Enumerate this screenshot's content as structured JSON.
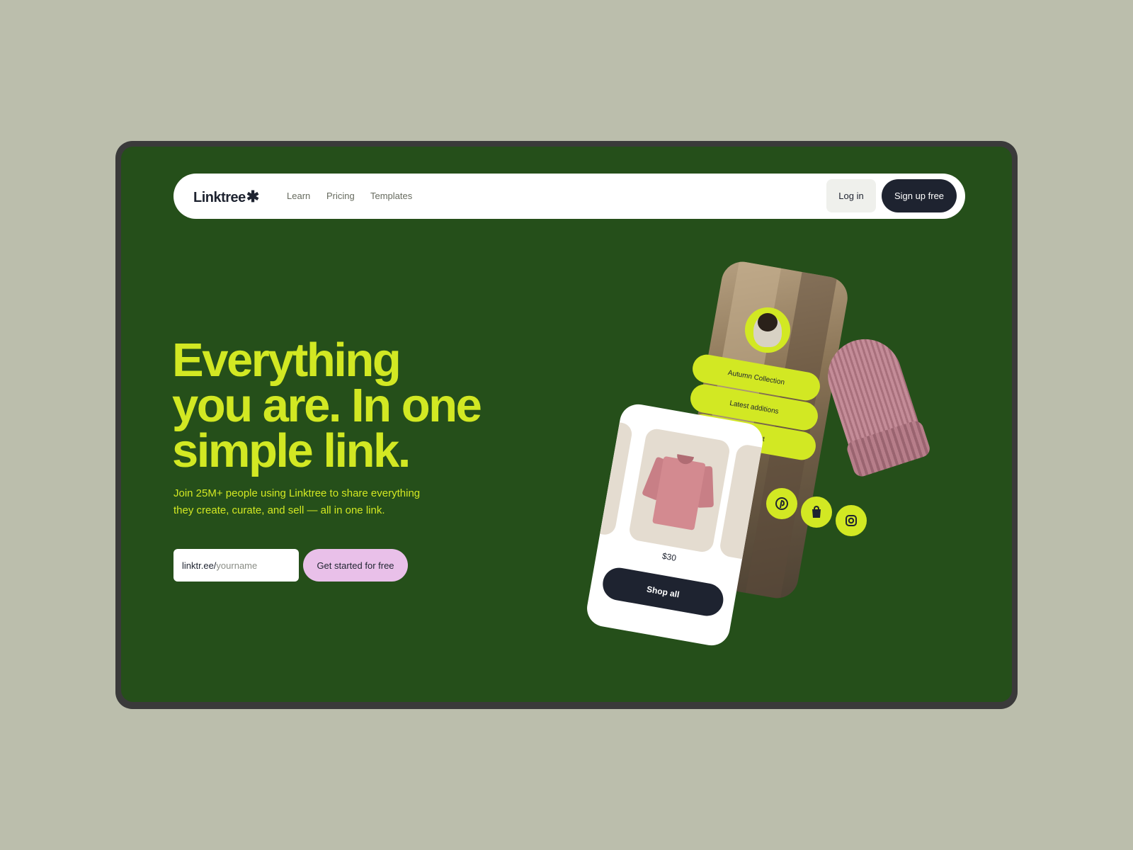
{
  "nav": {
    "logo_text": "Linktree",
    "logo_mark": "✱",
    "links": [
      "Learn",
      "Pricing",
      "Templates"
    ],
    "login_label": "Log in",
    "signup_label": "Sign up free"
  },
  "hero": {
    "headline_lines": [
      "Everything",
      "you are. In one",
      "simple link."
    ],
    "subtitle_lines": [
      "Join 25M+ people using Linktree to share everything",
      "they create, curate, and sell — all in one link."
    ],
    "url_prefix": "linktr.ee/",
    "url_placeholder": "yourname",
    "cta_label": "Get started for free"
  },
  "profile_card": {
    "links": [
      "Autumn Collection",
      "Latest additions",
      "Podcast"
    ]
  },
  "shop_card": {
    "price": "$30",
    "button_label": "Shop all"
  },
  "social_icons": [
    "pinterest-icon",
    "shopify-icon",
    "instagram-icon"
  ],
  "colors": {
    "background": "#bbbeac",
    "hero_green": "#254f1a",
    "accent_lime": "#d2e823",
    "cta_pink": "#e9c0e9",
    "dark": "#1e2330"
  }
}
